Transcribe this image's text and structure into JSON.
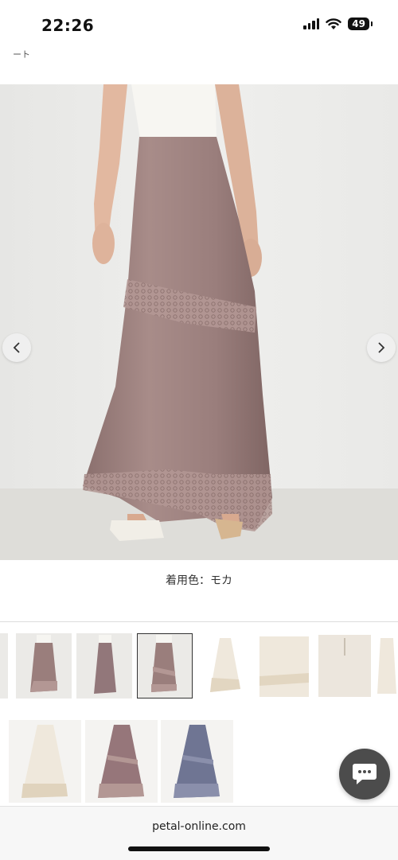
{
  "status_bar": {
    "time": "22:26",
    "battery": "49",
    "icons": [
      "signal-icon",
      "wifi-icon",
      "battery-icon"
    ]
  },
  "page": {
    "top_fragment": "ート"
  },
  "gallery": {
    "prev_icon": "chevron-left-icon",
    "next_icon": "chevron-right-icon",
    "caption": "着用色：モカ",
    "selected_thumbnail": 3,
    "thumbnail_count": 7,
    "skirt_color": "#9a7e7c"
  },
  "color_swatches": [
    {
      "color": "#efe8dc"
    },
    {
      "color": "#96767a"
    },
    {
      "color": "#6f7593"
    }
  ],
  "chat": {
    "icon": "chat-bubble-icon"
  },
  "browser": {
    "url": "petal-online.com"
  }
}
